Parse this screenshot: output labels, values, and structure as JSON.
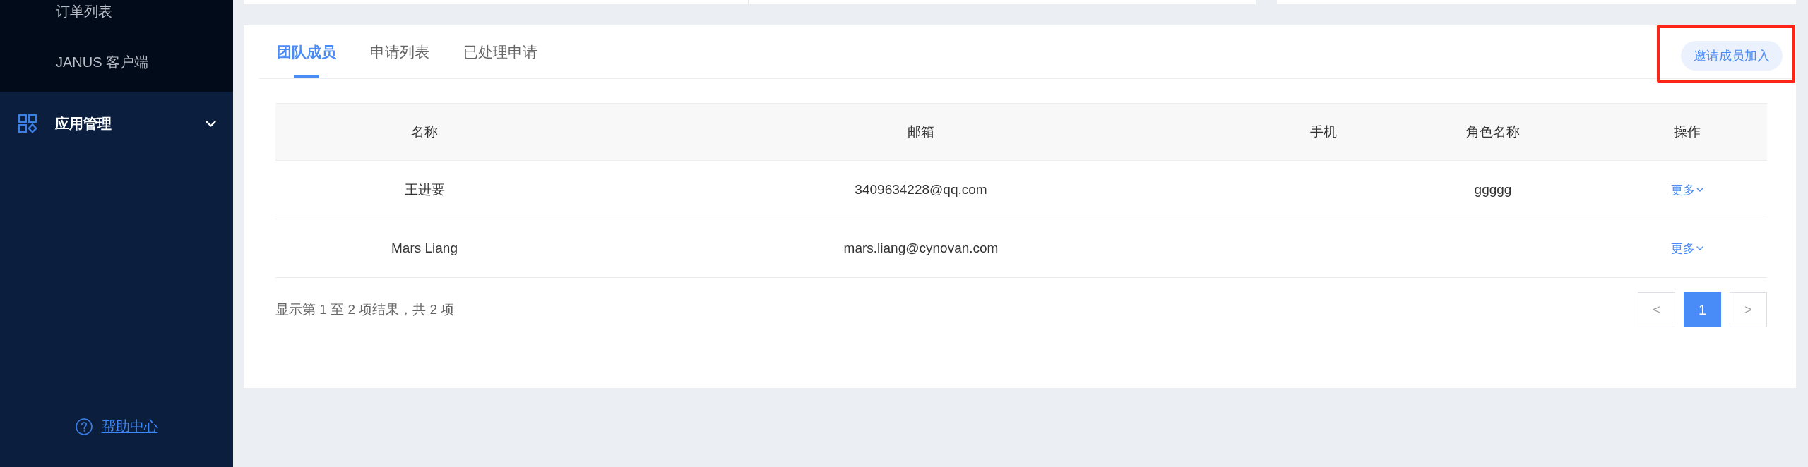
{
  "sidebar": {
    "submenu_items": [
      {
        "label": "订单列表"
      },
      {
        "label": "JANUS 客户端"
      }
    ],
    "groups": [
      {
        "label": "应用管理",
        "expanded": false
      }
    ],
    "help_link": "帮助中心"
  },
  "tabs": [
    {
      "label": "团队成员",
      "selected": true
    },
    {
      "label": "申请列表",
      "selected": false
    },
    {
      "label": "已处理申请",
      "selected": false
    }
  ],
  "invite_button": {
    "label": "邀请成员加入",
    "highlighted": true
  },
  "table": {
    "columns": [
      "名称",
      "邮箱",
      "手机",
      "角色名称",
      "操作"
    ],
    "rows": [
      {
        "name": "王进要",
        "email": "3409634228@qq.com",
        "role": "ggggg",
        "action": "更多"
      },
      {
        "name": "Mars Liang",
        "email": "mars.liang@cynovan.com",
        "action": "更多"
      }
    ]
  },
  "pagination": {
    "summary": "显示第 1 至 2 项结果，共 2 项",
    "prev": "<",
    "next": ">",
    "pages": [
      {
        "label": "1",
        "selected": true
      }
    ]
  }
}
